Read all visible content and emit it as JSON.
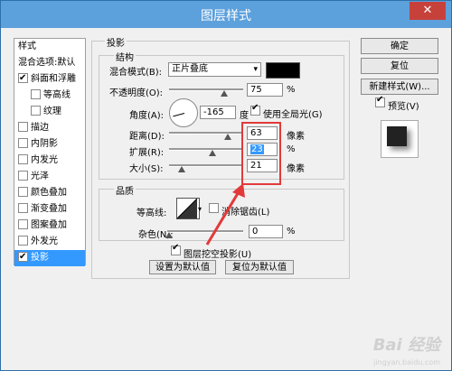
{
  "window": {
    "title": "图层样式",
    "close": "✕"
  },
  "sidebar": {
    "items": [
      {
        "label": "样式",
        "checkbox": false,
        "checked": false,
        "selected": false,
        "indent": false
      },
      {
        "label": "混合选项:默认",
        "checkbox": false,
        "checked": false,
        "selected": false,
        "indent": false
      },
      {
        "label": "斜面和浮雕",
        "checkbox": true,
        "checked": true,
        "selected": false,
        "indent": false
      },
      {
        "label": "等高线",
        "checkbox": true,
        "checked": false,
        "selected": false,
        "indent": true
      },
      {
        "label": "纹理",
        "checkbox": true,
        "checked": false,
        "selected": false,
        "indent": true
      },
      {
        "label": "描边",
        "checkbox": true,
        "checked": false,
        "selected": false,
        "indent": false
      },
      {
        "label": "内阴影",
        "checkbox": true,
        "checked": false,
        "selected": false,
        "indent": false
      },
      {
        "label": "内发光",
        "checkbox": true,
        "checked": false,
        "selected": false,
        "indent": false
      },
      {
        "label": "光泽",
        "checkbox": true,
        "checked": false,
        "selected": false,
        "indent": false
      },
      {
        "label": "颜色叠加",
        "checkbox": true,
        "checked": false,
        "selected": false,
        "indent": false
      },
      {
        "label": "渐变叠加",
        "checkbox": true,
        "checked": false,
        "selected": false,
        "indent": false
      },
      {
        "label": "图案叠加",
        "checkbox": true,
        "checked": false,
        "selected": false,
        "indent": false
      },
      {
        "label": "外发光",
        "checkbox": true,
        "checked": false,
        "selected": false,
        "indent": false
      },
      {
        "label": "投影",
        "checkbox": true,
        "checked": true,
        "selected": true,
        "indent": false
      }
    ]
  },
  "main": {
    "section_title": "投影",
    "structure": {
      "title": "结构",
      "blend_mode_label": "混合模式(B):",
      "blend_mode_value": "正片叠底",
      "opacity_label": "不透明度(O):",
      "opacity_value": "75",
      "angle_label": "角度(A):",
      "angle_value": "-165",
      "degree_unit": "度",
      "use_global_light_label": "使用全局光(G)",
      "use_global_light": true,
      "distance_label": "距离(D):",
      "distance_value": "63",
      "spread_label": "扩展(R):",
      "spread_value": "23",
      "size_label": "大小(S):",
      "size_value": "21",
      "pixel_unit": "像素",
      "percent_unit": "%"
    },
    "quality": {
      "title": "品质",
      "contour_label": "等高线:",
      "anti_alias_label": "消除锯齿(L)",
      "anti_alias": false,
      "noise_label": "杂色(N):",
      "noise_value": "0",
      "percent_unit": "%"
    },
    "knockout_label": "图层挖空投影(U)",
    "knockout": true,
    "set_default_label": "设置为默认值",
    "reset_default_label": "复位为默认值"
  },
  "right": {
    "ok_label": "确定",
    "reset_label": "复位",
    "new_style_label": "新建样式(W)...",
    "preview_label": "预览(V)",
    "preview": true
  },
  "watermark": {
    "text": "Bai 经验",
    "sub": "jingyan.baidu.com"
  },
  "colors": {
    "titlebar": "#5ca0dc",
    "selected": "#3399ff",
    "highlight": "#e23a3a"
  }
}
